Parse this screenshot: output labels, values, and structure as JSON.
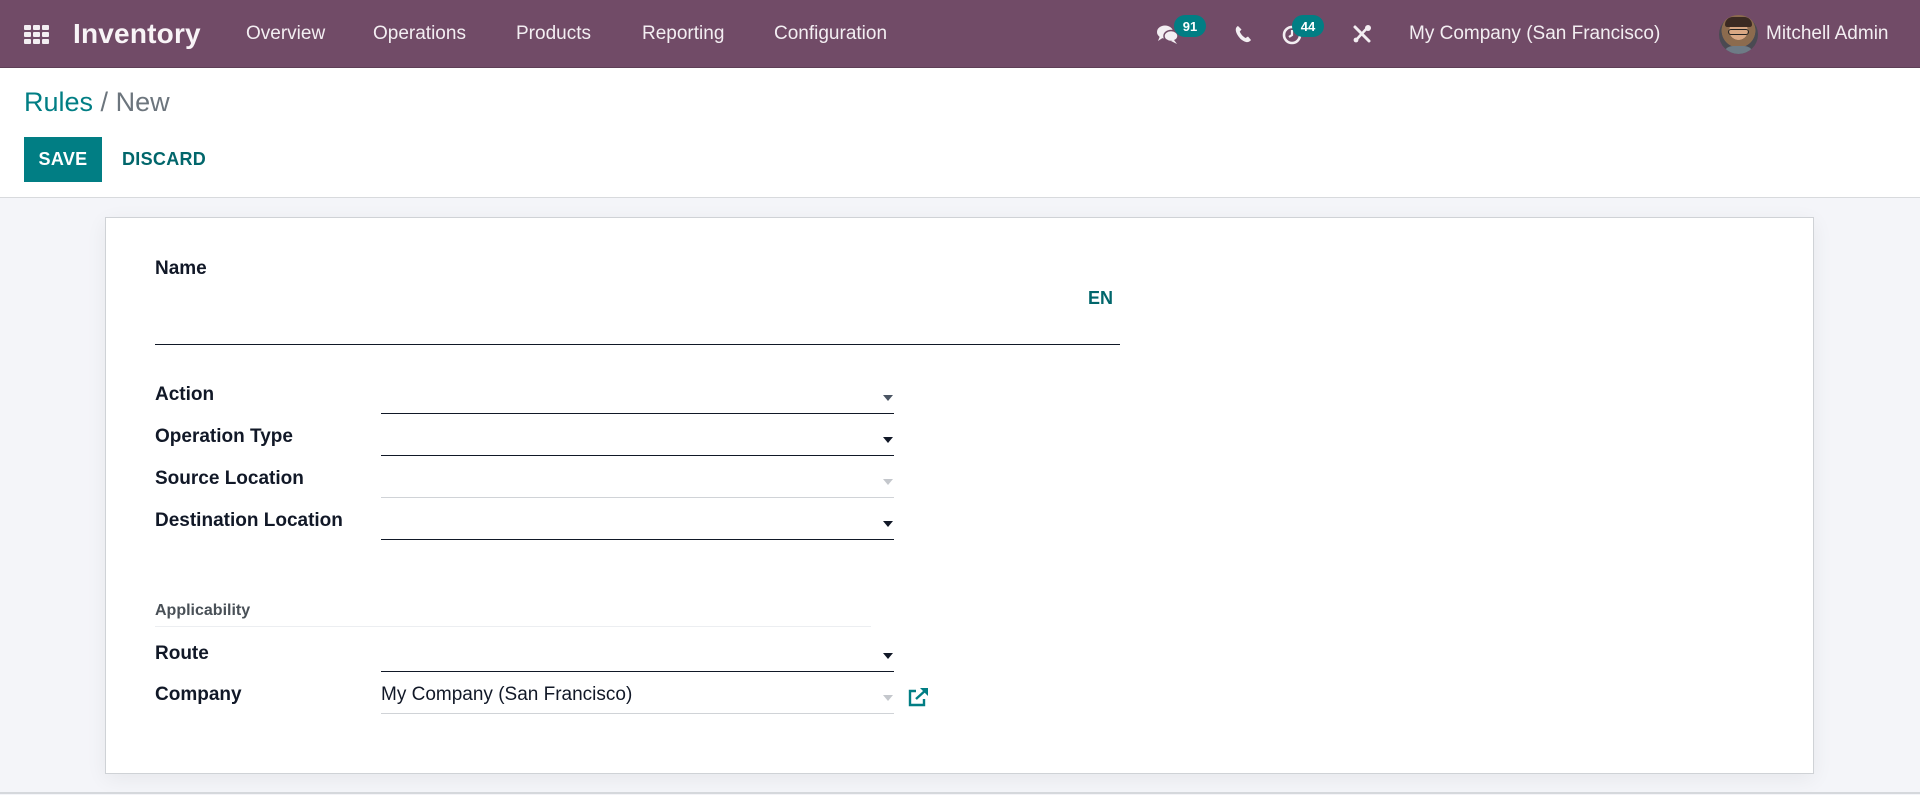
{
  "navbar": {
    "app_name": "Inventory",
    "menu": [
      "Overview",
      "Operations",
      "Products",
      "Reporting",
      "Configuration"
    ],
    "systray": {
      "messages_icon": "chat-bubbles-icon",
      "messages_count": "91",
      "phone_icon": "phone-icon",
      "activities_icon": "clock-icon",
      "activities_count": "44",
      "debug_icon": "tools-icon"
    },
    "company": "My Company (San Francisco)",
    "user": "Mitchell Admin"
  },
  "control_panel": {
    "breadcrumb": {
      "parent": "Rules",
      "separator": "/",
      "current": "New"
    },
    "save_label": "SAVE",
    "discard_label": "DISCARD"
  },
  "form": {
    "name": {
      "label": "Name",
      "value": "",
      "lang": "EN"
    },
    "fields": [
      {
        "label": "Action",
        "value": ""
      },
      {
        "label": "Operation Type",
        "value": ""
      },
      {
        "label": "Source Location",
        "value": ""
      },
      {
        "label": "Destination Location",
        "value": ""
      }
    ],
    "applicability": {
      "title": "Applicability",
      "route": {
        "label": "Route",
        "value": ""
      },
      "company": {
        "label": "Company",
        "value": "My Company (San Francisco)"
      }
    }
  },
  "colors": {
    "navbar": "#714b67",
    "primary": "#017e84",
    "page_bg": "#f4f5f9"
  }
}
